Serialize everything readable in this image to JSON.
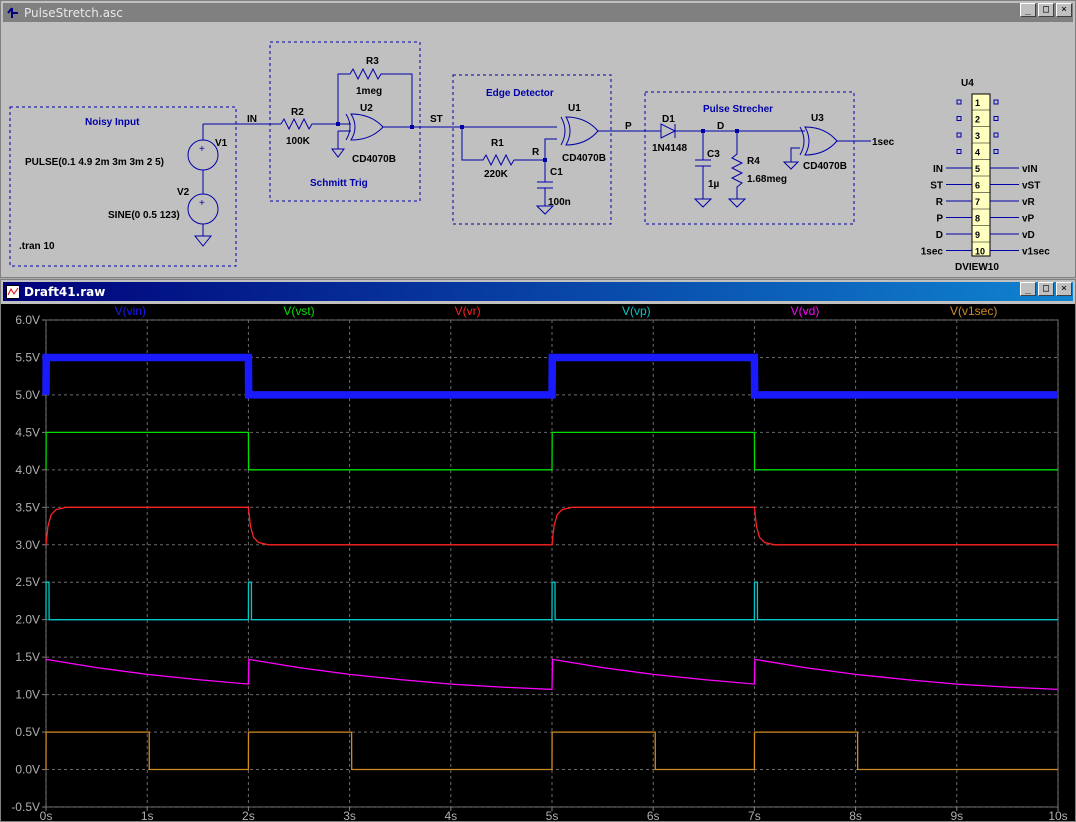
{
  "schematic_window": {
    "title": "PulseStretch.asc"
  },
  "plot_window": {
    "title": "Draft41.raw"
  },
  "window_controls": {
    "minimize": "_",
    "maximize": "□",
    "close": "×"
  },
  "schematic": {
    "boxes": {
      "noisy_input": "Noisy Input",
      "schmitt": "Schmitt Trig",
      "edge": "Edge Detector",
      "pulse": "Pulse Strecher"
    },
    "nets": {
      "in": "IN",
      "st": "ST",
      "p": "P",
      "r": "R",
      "d": "D",
      "out": "1sec"
    },
    "components": {
      "v1": {
        "ref": "V1",
        "value": "PULSE(0.1 4.9 2m 3m 3m 2 5)"
      },
      "v2": {
        "ref": "V2",
        "value": "SINE(0 0.5 123)"
      },
      "directive": ".tran 10",
      "r2": {
        "ref": "R2",
        "value": "100K"
      },
      "r3": {
        "ref": "R3",
        "value": "1meg"
      },
      "u2": {
        "ref": "U2",
        "value": "CD4070B"
      },
      "r1": {
        "ref": "R1",
        "value": "220K"
      },
      "c1": {
        "ref": "C1",
        "value": "100n"
      },
      "u1": {
        "ref": "U1",
        "value": "CD4070B"
      },
      "d1": {
        "ref": "D1",
        "value": "1N4148"
      },
      "c3": {
        "ref": "C3",
        "value": "1µ"
      },
      "r4": {
        "ref": "R4",
        "value": "1.68meg"
      },
      "u3": {
        "ref": "U3",
        "value": "CD4070B"
      },
      "u4": {
        "ref": "U4",
        "value": "DVIEW10"
      }
    },
    "dview": {
      "pins": [
        "1",
        "2",
        "3",
        "4",
        "5",
        "6",
        "7",
        "8",
        "9",
        "10"
      ],
      "left_labels": [
        "",
        "",
        "",
        "",
        "IN",
        "ST",
        "R",
        "P",
        "D",
        "1sec"
      ],
      "right_labels": [
        "",
        "",
        "",
        "",
        "vIN",
        "vST",
        "vR",
        "vP",
        "vD",
        "v1sec"
      ]
    }
  },
  "chart_data": {
    "type": "line",
    "title": "",
    "xlabel": "",
    "ylabel": "",
    "xlim": [
      0,
      10
    ],
    "ylim": [
      -0.5,
      6.0
    ],
    "x_ticks": [
      "0s",
      "1s",
      "2s",
      "3s",
      "4s",
      "5s",
      "6s",
      "7s",
      "8s",
      "9s",
      "10s"
    ],
    "y_ticks": [
      "-0.5V",
      "0.0V",
      "0.5V",
      "1.0V",
      "1.5V",
      "2.0V",
      "2.5V",
      "3.0V",
      "3.5V",
      "4.0V",
      "4.5V",
      "5.0V",
      "5.5V",
      "6.0V"
    ],
    "grid": true,
    "background": "#000000",
    "legend": "top",
    "series": [
      {
        "name": "V(vin)",
        "color": "#1a1aff",
        "x": [
          0,
          0.002,
          2,
          2.003,
          5,
          5.003,
          7,
          7.003,
          10
        ],
        "y": [
          5.0,
          5.5,
          5.5,
          5.0,
          5.0,
          5.5,
          5.5,
          5.0,
          5.0
        ],
        "noise_band": 0.05
      },
      {
        "name": "V(vst)",
        "color": "#00e000",
        "x": [
          0,
          0.002,
          2.0,
          2.002,
          5.0,
          5.002,
          7.0,
          7.002,
          10
        ],
        "y": [
          4.0,
          4.5,
          4.5,
          4.0,
          4.0,
          4.5,
          4.5,
          4.0,
          4.0
        ]
      },
      {
        "name": "V(vr)",
        "color": "#ff2020",
        "x": [
          0,
          0.02,
          0.05,
          0.1,
          0.2,
          2.0,
          2.02,
          2.05,
          2.1,
          2.2,
          5.0,
          5.02,
          5.05,
          5.1,
          5.2,
          7.0,
          7.02,
          7.05,
          7.1,
          7.2,
          10
        ],
        "y": [
          3.0,
          3.25,
          3.4,
          3.47,
          3.5,
          3.5,
          3.25,
          3.1,
          3.03,
          3.0,
          3.0,
          3.25,
          3.4,
          3.47,
          3.5,
          3.5,
          3.25,
          3.1,
          3.03,
          3.0,
          3.0
        ]
      },
      {
        "name": "V(vp)",
        "color": "#00c8c8",
        "x": [
          0,
          0.001,
          0.03,
          0.031,
          2.0,
          2.001,
          2.03,
          2.031,
          5.0,
          5.001,
          5.03,
          5.031,
          7.0,
          7.001,
          7.03,
          7.031,
          10
        ],
        "y": [
          2.0,
          2.5,
          2.5,
          2.0,
          2.0,
          2.5,
          2.5,
          2.0,
          2.0,
          2.5,
          2.5,
          2.0,
          2.0,
          2.5,
          2.5,
          2.0,
          2.0
        ]
      },
      {
        "name": "V(vd)",
        "color": "#ff00ff",
        "x": [
          0,
          0.5,
          1.0,
          1.5,
          2.0,
          2.005,
          2.5,
          3.0,
          3.5,
          4.0,
          4.5,
          5.0,
          5.005,
          5.5,
          6.0,
          6.5,
          7.0,
          7.005,
          7.5,
          8.0,
          8.5,
          9.0,
          9.5,
          10
        ],
        "y": [
          1.47,
          1.36,
          1.27,
          1.2,
          1.14,
          1.47,
          1.36,
          1.27,
          1.2,
          1.14,
          1.1,
          1.07,
          1.47,
          1.36,
          1.27,
          1.2,
          1.14,
          1.47,
          1.36,
          1.27,
          1.2,
          1.14,
          1.1,
          1.07
        ]
      },
      {
        "name": "V(v1sec)",
        "color": "#d08a20",
        "x": [
          0,
          0.001,
          1.02,
          1.021,
          2.0,
          2.001,
          3.02,
          3.021,
          5.0,
          5.001,
          6.02,
          6.021,
          7.0,
          7.001,
          8.02,
          8.021,
          10
        ],
        "y": [
          0.0,
          0.5,
          0.5,
          0.0,
          0.0,
          0.5,
          0.5,
          0.0,
          0.0,
          0.5,
          0.5,
          0.0,
          0.0,
          0.5,
          0.5,
          0.0,
          0.0
        ]
      }
    ]
  }
}
